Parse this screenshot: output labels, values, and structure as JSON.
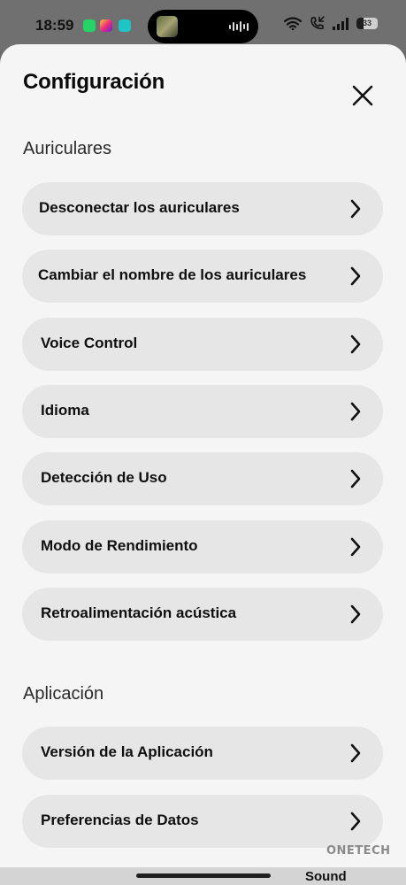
{
  "status_bar": {
    "time": "18:59",
    "battery": "33",
    "notification_apps": [
      "whatsapp-icon",
      "instagram-icon",
      "app-icon"
    ]
  },
  "sheet": {
    "title": "Configuración"
  },
  "sections": [
    {
      "header": "Auriculares",
      "items": [
        {
          "label": "Desconectar los auriculares"
        },
        {
          "label": "Cambiar el nombre de los auriculares"
        },
        {
          "label": "Voice Control"
        },
        {
          "label": "Idioma"
        },
        {
          "label": "Detección de Uso"
        },
        {
          "label": "Modo de Rendimiento"
        },
        {
          "label": "Retroalimentación acústica"
        }
      ]
    },
    {
      "header": "Aplicación",
      "items": [
        {
          "label": "Versión de la Aplicación"
        },
        {
          "label": "Preferencias de Datos"
        }
      ]
    }
  ],
  "bottom": {
    "text": "Sound"
  },
  "watermark": "ONETECH",
  "colors": {
    "sheet_background": "#f5f5f5",
    "row_background": "#e6e6e6",
    "text": "#0f0f0f"
  }
}
